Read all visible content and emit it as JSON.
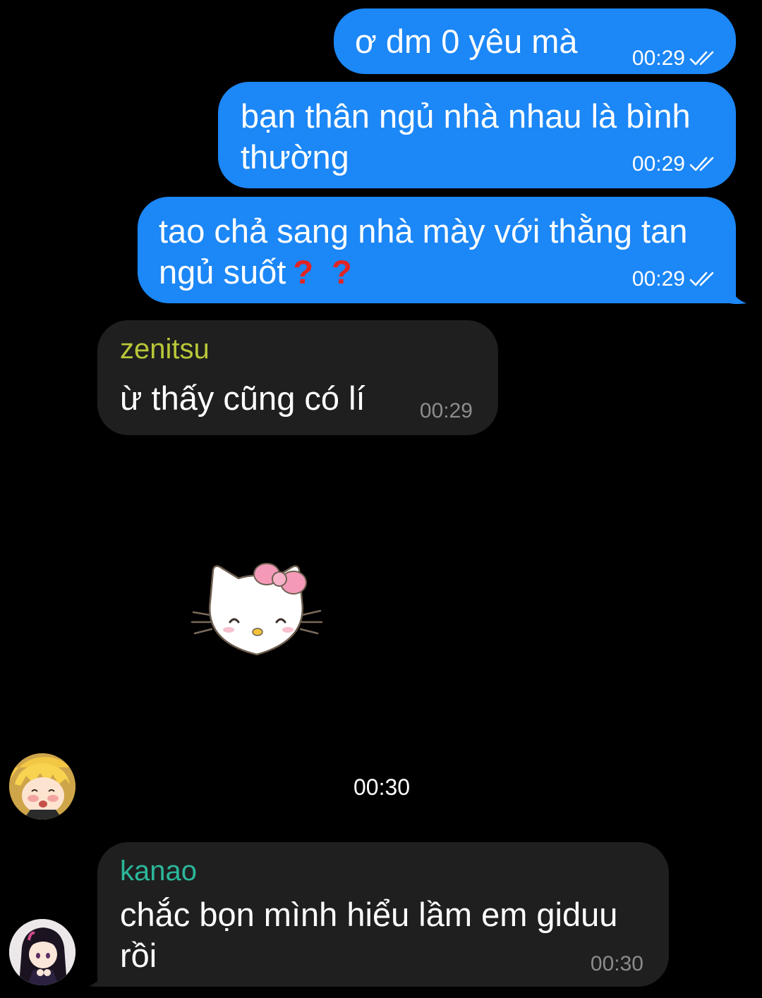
{
  "messages": [
    {
      "text": "ơ dm 0 yêu mà",
      "time": "00:29"
    },
    {
      "line1": "bạn thân ngủ nhà nhau là bình",
      "line2": "thường",
      "time": "00:29"
    },
    {
      "line1": "tao chả sang nhà mày với thằng tan",
      "line2": "ngủ suốt",
      "q1": "?",
      "q2": "?",
      "time": "00:29"
    },
    {
      "sender": "zenitsu",
      "text": "ừ thấy cũng có lí",
      "time": "00:29",
      "sender_color": "#b9c738"
    },
    {
      "sticker": "hello-kitty-sticker",
      "time": "00:30"
    },
    {
      "sender": "kanao",
      "line1": "chắc bọn mình hiểu lầm em giduu",
      "line2": "rồi",
      "time": "00:30",
      "sender_color": "#2bb79a"
    }
  ],
  "colors": {
    "outgoing": "#1c87f6",
    "incoming": "#1f1f1f",
    "background": "#000000"
  }
}
